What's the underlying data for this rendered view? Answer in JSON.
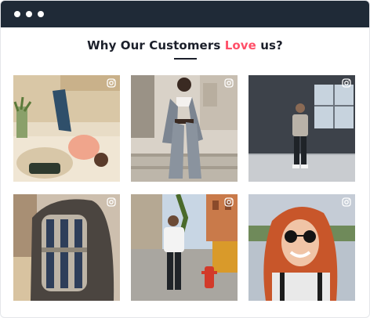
{
  "window": {
    "controls": [
      "close-dot",
      "minimize-dot",
      "maximize-dot"
    ]
  },
  "heading": {
    "prefix": "Why Our Customers ",
    "accent": "Love",
    "suffix": " us?"
  },
  "colors": {
    "titlebar": "#1f2a37",
    "accent": "#ff4f68",
    "text": "#1b1f2a"
  },
  "tiles": [
    {
      "icon": "instagram-icon"
    },
    {
      "icon": "instagram-icon"
    },
    {
      "icon": "instagram-icon"
    },
    {
      "icon": "instagram-icon"
    },
    {
      "icon": "instagram-icon"
    },
    {
      "icon": "instagram-icon"
    }
  ]
}
